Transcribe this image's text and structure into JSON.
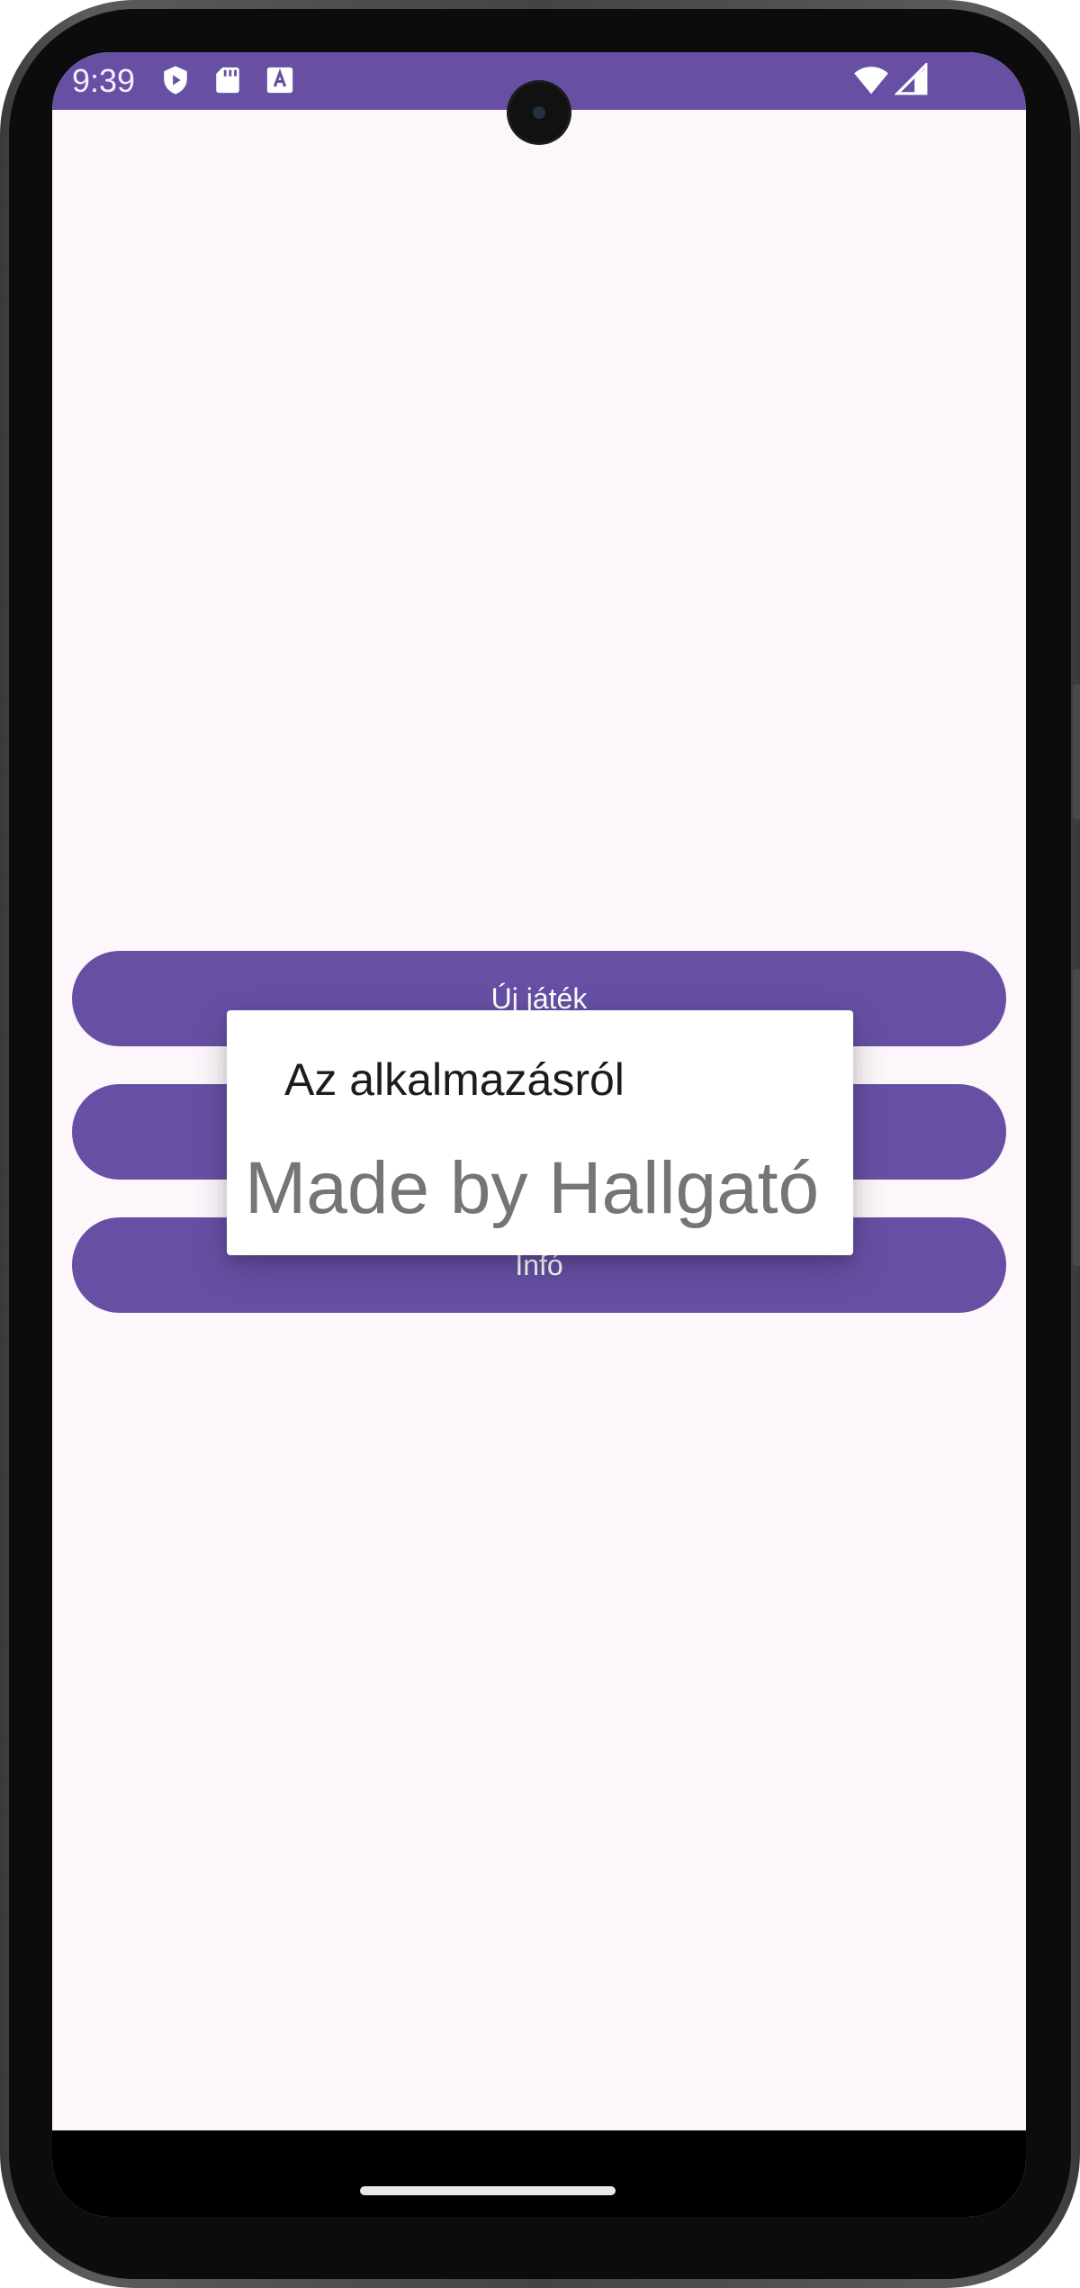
{
  "status_bar": {
    "time": "9:39",
    "icons": [
      "play-protect-icon",
      "sd-card-icon",
      "keyboard-a-icon",
      "wifi-icon",
      "signal-icon"
    ],
    "color": "#6750a4"
  },
  "menu": {
    "buttons": [
      {
        "label": "Új játék"
      },
      {
        "label": ""
      },
      {
        "label": "Infó"
      }
    ],
    "button_color": "#6750a4"
  },
  "dialog": {
    "title": "Az alkalmazásról",
    "message": "Made by Hallgató"
  },
  "colors": {
    "background": "#fdf7fc",
    "accent": "#6750a4"
  }
}
